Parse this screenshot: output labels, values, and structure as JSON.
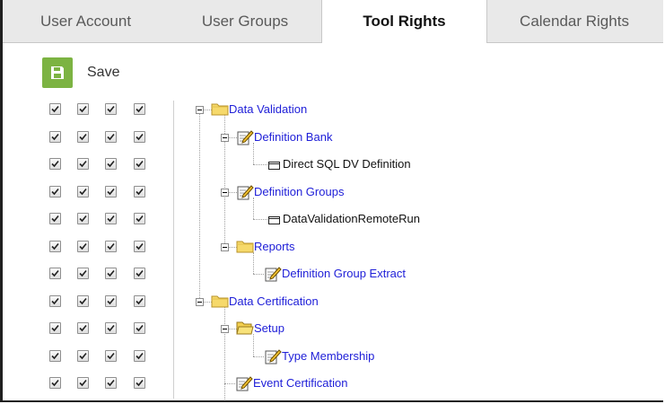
{
  "tabs": [
    {
      "label": "User Account",
      "active": false
    },
    {
      "label": "User Groups",
      "active": false
    },
    {
      "label": "Tool Rights",
      "active": true
    },
    {
      "label": "Calendar Rights",
      "active": false
    }
  ],
  "toolbar": {
    "save_label": "Save"
  },
  "permission_rows": [
    [
      true,
      true,
      true,
      true
    ],
    [
      true,
      true,
      true,
      true
    ],
    [
      true,
      true,
      true,
      true
    ],
    [
      true,
      true,
      true,
      true
    ],
    [
      true,
      true,
      true,
      true
    ],
    [
      true,
      true,
      true,
      true
    ],
    [
      true,
      true,
      true,
      true
    ],
    [
      true,
      true,
      true,
      true
    ],
    [
      true,
      true,
      true,
      true
    ],
    [
      true,
      true,
      true,
      true
    ],
    [
      true,
      true,
      true,
      true
    ]
  ],
  "tree": [
    {
      "label": "Data Validation",
      "icon": "folder-icon",
      "style": "link",
      "expanded": true
    },
    {
      "label": "Definition Bank",
      "icon": "edit-document-icon",
      "style": "link",
      "expanded": true
    },
    {
      "label": "Direct SQL DV Definition",
      "icon": "document-icon",
      "style": "plain"
    },
    {
      "label": "Definition Groups",
      "icon": "edit-document-icon",
      "style": "link",
      "expanded": true
    },
    {
      "label": "DataValidationRemoteRun",
      "icon": "document-icon",
      "style": "plain"
    },
    {
      "label": "Reports",
      "icon": "folder-icon",
      "style": "link",
      "expanded": true
    },
    {
      "label": "Definition Group Extract",
      "icon": "edit-document-icon",
      "style": "link"
    },
    {
      "label": "Data Certification",
      "icon": "folder-icon",
      "style": "link",
      "expanded": true
    },
    {
      "label": "Setup",
      "icon": "folder-open-icon",
      "style": "link",
      "expanded": true
    },
    {
      "label": "Type Membership",
      "icon": "edit-document-icon",
      "style": "link"
    },
    {
      "label": "Event Certification",
      "icon": "edit-document-icon",
      "style": "link"
    }
  ],
  "colors": {
    "accent_green": "#7cb342",
    "link_blue": "#2020d8",
    "folder_yellow": "#f6d96b"
  }
}
